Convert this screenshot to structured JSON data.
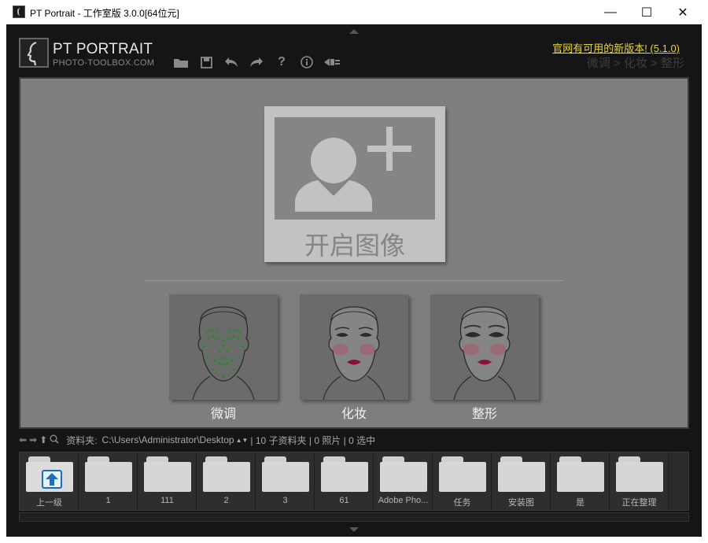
{
  "window": {
    "title": "PT Portrait - 工作室版 3.0.0[64位元]",
    "minimize": "—",
    "maximize": "☐",
    "close": "✕"
  },
  "header": {
    "brand": "PT PORTRAIT",
    "brand_sub": "PHOTO-TOOLBOX.COM",
    "update_link": "官网有可用的新版本! (5.1.0)",
    "breadcrumb": "微调 > 化妆 > 整形",
    "toolbar": [
      {
        "icon": "folder-open-icon",
        "glyph": "▬"
      },
      {
        "icon": "save-icon",
        "glyph": "▣"
      },
      {
        "icon": "undo-icon",
        "glyph": "↶"
      },
      {
        "icon": "redo-icon",
        "glyph": "↷"
      },
      {
        "icon": "help-icon",
        "glyph": "?"
      },
      {
        "icon": "info-icon",
        "glyph": "ⓘ"
      },
      {
        "icon": "plugin-icon",
        "glyph": "◂⊏"
      }
    ]
  },
  "canvas": {
    "open_image_label": "开启图像",
    "modes": [
      {
        "label": "微调"
      },
      {
        "label": "化妆"
      },
      {
        "label": "整形"
      }
    ]
  },
  "statusbar": {
    "folder_label": "资料夹:",
    "folder_path": "C:\\Users\\Administrator\\Desktop",
    "stats": "| 10 子资料夹 | 0 照片 | 0 选中"
  },
  "folders": [
    {
      "name": "上一级"
    },
    {
      "name": "1"
    },
    {
      "name": "111"
    },
    {
      "name": "2"
    },
    {
      "name": "3"
    },
    {
      "name": "61"
    },
    {
      "name": "Adobe Pho..."
    },
    {
      "name": "任务"
    },
    {
      "name": "安装图"
    },
    {
      "name": "是"
    },
    {
      "name": "正在整理"
    }
  ],
  "colors": {
    "accent_link": "#e8d630",
    "canvas_bg": "#7e7e7e",
    "app_bg": "#151515"
  }
}
